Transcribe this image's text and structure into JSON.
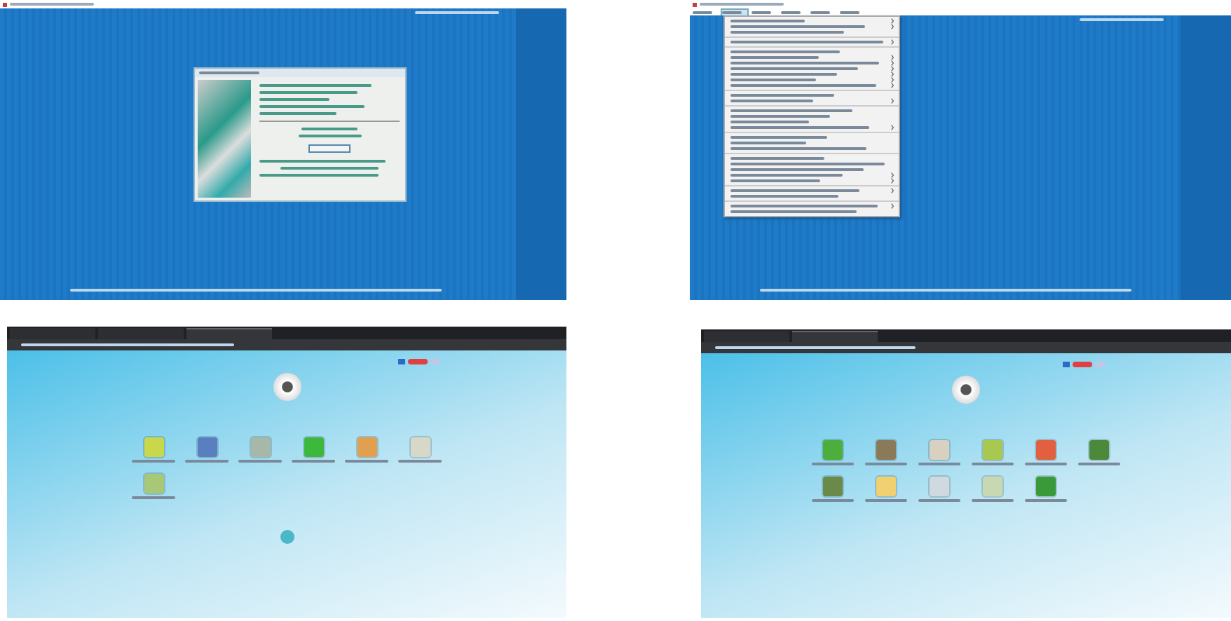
{
  "panels": [
    {
      "kind": "dialog_screen",
      "dialog": {
        "open": true
      }
    },
    {
      "kind": "menu_screen",
      "menu_bar": [
        {
          "selected": false
        },
        {
          "selected": true
        },
        {
          "selected": false
        },
        {
          "selected": false
        },
        {
          "selected": false
        },
        {
          "selected": false
        }
      ],
      "menu_items": [
        {
          "kind": "item",
          "submenu": true
        },
        {
          "kind": "item",
          "submenu": true
        },
        {
          "kind": "item",
          "submenu": false
        },
        {
          "kind": "separator"
        },
        {
          "kind": "item",
          "submenu": true
        },
        {
          "kind": "separator"
        },
        {
          "kind": "item",
          "submenu": false
        },
        {
          "kind": "item",
          "submenu": true
        },
        {
          "kind": "item",
          "submenu": true
        },
        {
          "kind": "item",
          "submenu": true
        },
        {
          "kind": "item",
          "submenu": true
        },
        {
          "kind": "item",
          "submenu": true
        },
        {
          "kind": "item",
          "submenu": true
        },
        {
          "kind": "separator"
        },
        {
          "kind": "item",
          "submenu": false
        },
        {
          "kind": "item",
          "submenu": true
        },
        {
          "kind": "separator"
        },
        {
          "kind": "item",
          "submenu": false
        },
        {
          "kind": "item",
          "submenu": false
        },
        {
          "kind": "item",
          "submenu": false
        },
        {
          "kind": "item",
          "submenu": true
        },
        {
          "kind": "separator"
        },
        {
          "kind": "item",
          "submenu": false
        },
        {
          "kind": "item",
          "submenu": false
        },
        {
          "kind": "item",
          "submenu": false
        },
        {
          "kind": "separator"
        },
        {
          "kind": "item",
          "submenu": false
        },
        {
          "kind": "item",
          "submenu": false
        },
        {
          "kind": "item",
          "submenu": false
        },
        {
          "kind": "item",
          "submenu": true
        },
        {
          "kind": "item",
          "submenu": true
        },
        {
          "kind": "separator"
        },
        {
          "kind": "item",
          "submenu": true
        },
        {
          "kind": "item",
          "submenu": false
        },
        {
          "kind": "separator"
        },
        {
          "kind": "item",
          "submenu": true
        },
        {
          "kind": "item",
          "submenu": false
        }
      ]
    },
    {
      "kind": "portal_screen",
      "tabs": [
        {
          "selected": false
        },
        {
          "selected": false
        },
        {
          "selected": true
        }
      ],
      "apps": [
        {
          "color": "#c8d84a"
        },
        {
          "color": "#5a7fc0"
        },
        {
          "color": "#a8b8a8"
        },
        {
          "color": "#3cb83c"
        },
        {
          "color": "#e0a050"
        },
        {
          "color": "#d8d8c8"
        },
        {
          "color": "#a8c878"
        }
      ],
      "scroll_button": true
    },
    {
      "kind": "portal_screen",
      "tabs": [
        {
          "selected": false
        },
        {
          "selected": true
        }
      ],
      "apps": [
        {
          "color": "#4caf3c"
        },
        {
          "color": "#8a7a5a"
        },
        {
          "color": "#d8d0c0"
        },
        {
          "color": "#a8c850"
        },
        {
          "color": "#e06040"
        },
        {
          "color": "#4a8a3a"
        },
        {
          "color": "#6a8a4a"
        },
        {
          "color": "#f0d070"
        },
        {
          "color": "#d0d8e0"
        },
        {
          "color": "#c8d8b0"
        },
        {
          "color": "#3a9a3a"
        }
      ]
    }
  ]
}
